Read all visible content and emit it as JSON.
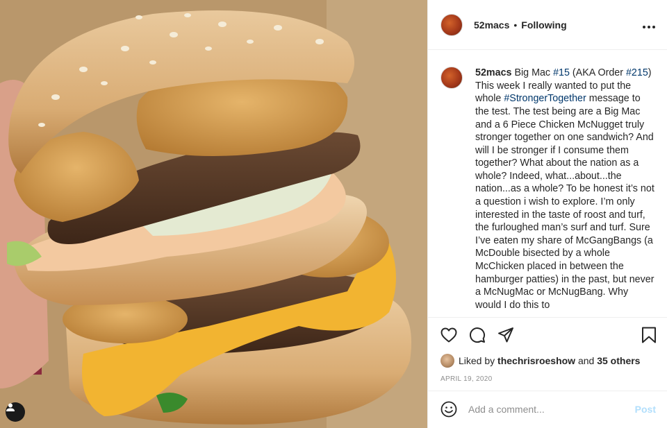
{
  "header": {
    "username": "52macs",
    "separator": "•",
    "follow_status": "Following",
    "more_icon": "more-options-icon"
  },
  "caption": {
    "username": "52macs",
    "text_1": " Big Mac ",
    "hashtag_1": "#15",
    "text_2": " (AKA Order ",
    "hashtag_2": "#215",
    "text_3": ") This week I really wanted to put the whole ",
    "hashtag_3": "#StrongerTogether",
    "text_4": " message to the test. The test being are a Big Mac and a 6 Piece Chicken McNugget truly stronger together on one sandwich? And will I be stronger if I consume them together? What about the nation as a whole? Indeed, what...about...the nation...as a whole? To be honest it’s not a question i wish to explore. I’m only interested in the taste of roost and turf, the furloughed man’s surf and turf. Sure I’ve eaten my share of McGangBangs (a McDouble bisected by a whole McChicken placed in between the hamburger patties) in the past, but never a McNugMac or McNugBang. Why would I do this to"
  },
  "actions": {
    "like_icon": "heart-icon",
    "comment_icon": "comment-icon",
    "share_icon": "share-icon",
    "save_icon": "bookmark-icon"
  },
  "likes": {
    "prefix": "Liked by ",
    "user": "thechrisroeshow",
    "middle": " and ",
    "others": "35 others"
  },
  "date": "APRIL 19, 2020",
  "comment": {
    "placeholder": "Add a comment...",
    "post_label": "Post",
    "emoji_icon": "emoji-icon"
  },
  "photo": {
    "tag_icon": "user-tag-icon"
  }
}
